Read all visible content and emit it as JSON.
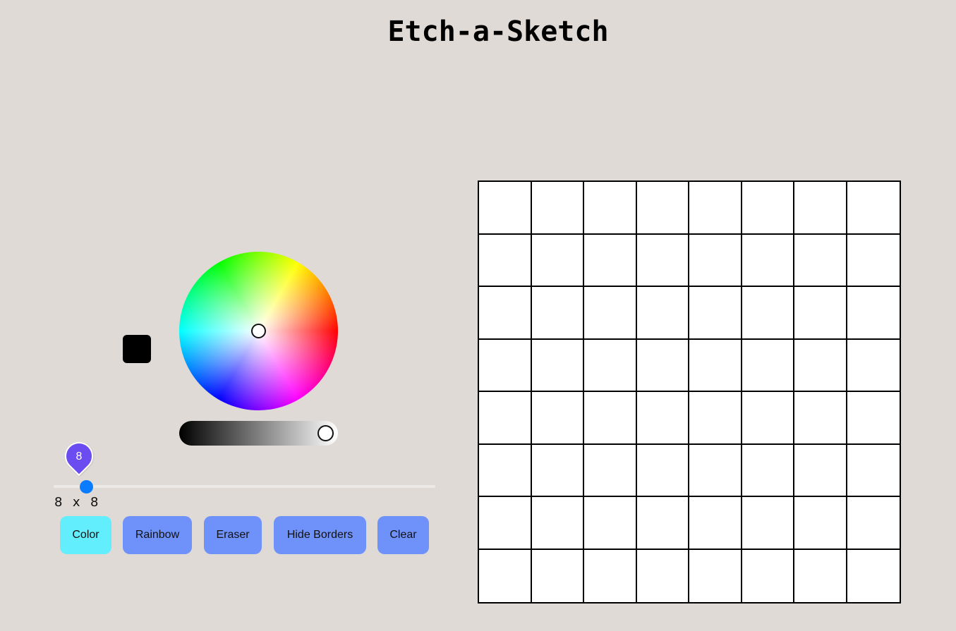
{
  "title": "Etch-a-Sketch",
  "current_color": "#000000",
  "slider": {
    "value": "8",
    "grid_label": "8  x  8"
  },
  "buttons": {
    "color": "Color",
    "rainbow": "Rainbow",
    "eraser": "Eraser",
    "hide_borders": "Hide Borders",
    "clear": "Clear"
  },
  "active_mode": "color",
  "colors": {
    "background": "#dfdad6",
    "button": "#6f92fa",
    "button_active": "#62eefc",
    "slider_thumb": "#0a7cff",
    "slider_bubble": "#6a4cf0"
  },
  "board": {
    "grid_size": 8
  }
}
